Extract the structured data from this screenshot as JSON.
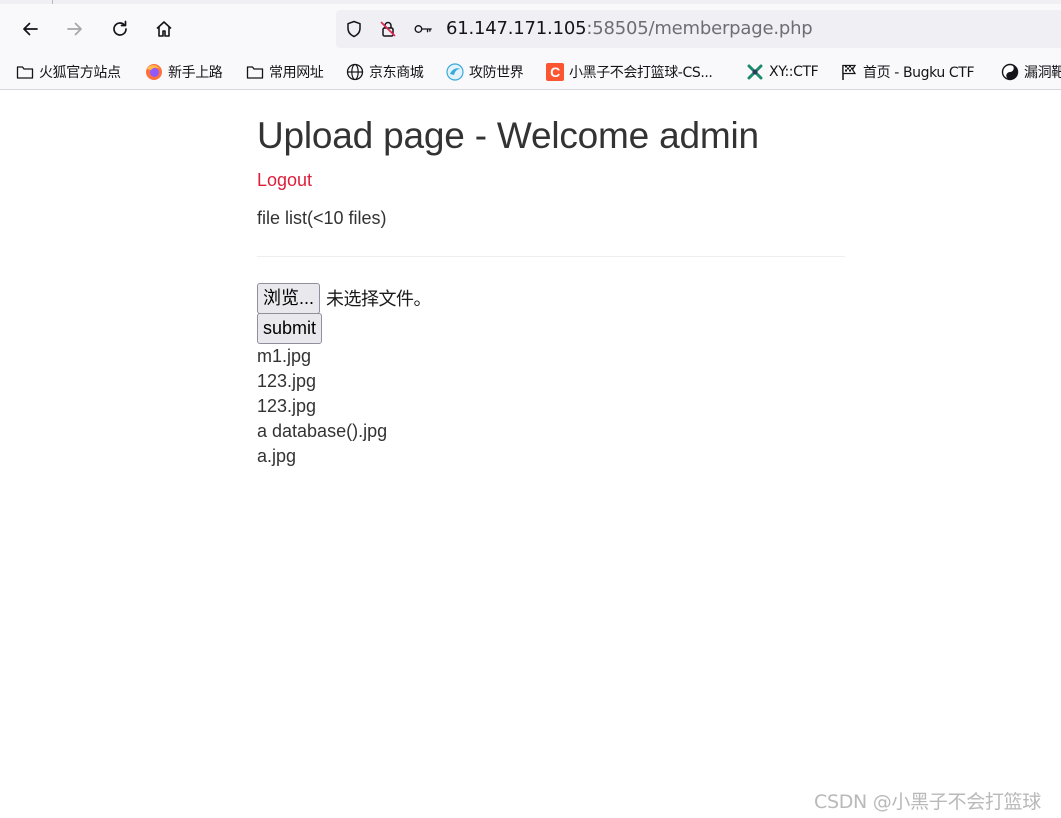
{
  "browser": {
    "url": {
      "host": "61.147.171.105",
      "rest": ":58505/memberpage.php"
    },
    "icons": {
      "back": "arrow-left-icon",
      "forward": "arrow-right-icon",
      "reload": "reload-icon",
      "home": "home-icon",
      "tracking": "shield-icon",
      "insecure": "insecure-lock-icon",
      "key": "key-icon"
    },
    "bookmarks": [
      {
        "label": "火狐官方站点",
        "icon": "folder-icon"
      },
      {
        "label": "新手上路",
        "icon": "firefox-icon"
      },
      {
        "label": "常用网址",
        "icon": "folder-icon"
      },
      {
        "label": "京东商城",
        "icon": "globe-icon"
      },
      {
        "label": "攻防世界",
        "icon": "site-icon"
      },
      {
        "label": "小黑子不会打篮球-CS...",
        "icon": "csdn-icon"
      },
      {
        "label": "XY::CTF",
        "icon": "site-icon"
      },
      {
        "label": "首页 - Bugku CTF",
        "icon": "flag-icon"
      },
      {
        "label": "漏洞靶",
        "icon": "site-icon"
      }
    ]
  },
  "page": {
    "title": "Upload page - Welcome admin",
    "logout": "Logout",
    "file_list_caption": "file list(<10 files)",
    "browse_label": "浏览...",
    "no_file_text": "未选择文件。",
    "submit_label": "submit",
    "files": [
      "m1.jpg",
      "123.jpg",
      "123.jpg",
      "a database().jpg",
      "a.jpg"
    ]
  },
  "watermark": "CSDN @小黑子不会打篮球",
  "colors": {
    "link": "#dd1f3a",
    "text": "#333333",
    "chrome": "#f9f9fb",
    "urlbar": "#f0f0f4"
  }
}
